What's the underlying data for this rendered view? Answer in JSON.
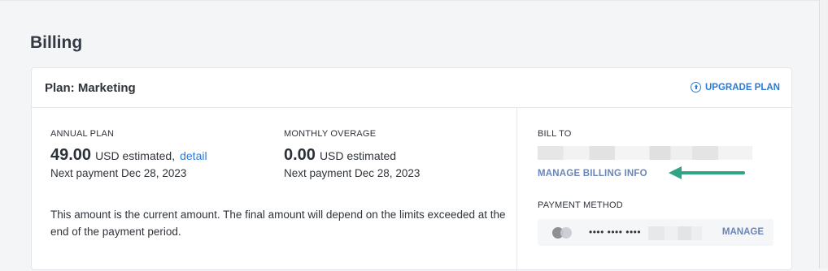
{
  "page": {
    "title": "Billing"
  },
  "plan_card": {
    "title": "Plan: Marketing",
    "upgrade_label": "UPGRADE PLAN",
    "annual": {
      "label": "ANNUAL PLAN",
      "amount": "49.00",
      "unit": "USD estimated,",
      "detail_link": "detail",
      "next_payment": "Next payment Dec 28, 2023"
    },
    "monthly": {
      "label": "MONTHLY OVERAGE",
      "amount": "0.00",
      "unit": "USD estimated",
      "next_payment": "Next payment Dec 28, 2023"
    },
    "note": "This amount is the current amount. The final amount will depend on the limits exceeded at the end of the payment period.",
    "bill_to": {
      "label": "BILL TO",
      "manage_label": "MANAGE BILLING INFO"
    },
    "payment_method": {
      "label": "PAYMENT METHOD",
      "masked_number": "•••• •••• ••••",
      "manage_label": "MANAGE"
    }
  },
  "colors": {
    "accent": "#2a7bd8",
    "link_muted": "#6a86b8",
    "annotation_arrow": "#2fa586"
  },
  "icons": [
    "arrow-up-circle-icon",
    "credit-card-icon",
    "annotation-arrow-icon"
  ]
}
